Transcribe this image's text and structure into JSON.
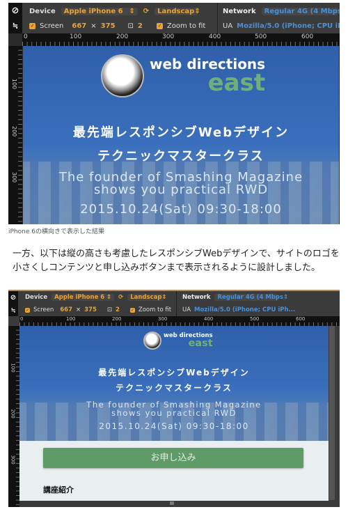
{
  "devtools": {
    "device_label": "Device",
    "device_value": "Apple iPhone 6",
    "orientation": "Landscap",
    "network_label": "Network",
    "network_value": "Regular 4G (4 Mbps",
    "screen_label": "Screen",
    "screen_w": "667",
    "times": "×",
    "screen_h": "375",
    "dpr": "2",
    "zoom_label": "Zoom to fit",
    "ua_label": "UA",
    "ua_value": "Mozilla/5.0 (iPhone; CPU iPh...",
    "ruler_ticks": [
      "0",
      "100",
      "200",
      "300",
      "400",
      "500",
      "600"
    ],
    "vruler_ticks": [
      "100",
      "200",
      "300"
    ],
    "icons": [
      "no-entry-icon",
      "emulation-icon",
      "rotate-icon",
      "dpr-icon",
      "select-arrows-icon",
      "checkbox-icon"
    ]
  },
  "site": {
    "logo_line1": "web directions",
    "logo_line2": "east",
    "title1": "最先端レスポンシブWebデザイン",
    "title2": "テクニックマスタークラス",
    "sub1": "The founder of Smashing Magazine",
    "sub2": "shows you practical RWD",
    "date": "2015.10.24(Sat) 09:30-18:00",
    "apply_button": "お申し込み",
    "section_heading": "講座紹介"
  },
  "article": {
    "caption1": "iPhone 6の横向きで表示した結果",
    "paragraph": "一方、以下は縦の高さも考慮したレスポンシブWebデザインで、サイトのロゴを小さくしコンテンツと申し込みボタンまで表示されるように設計しました。"
  },
  "colors": {
    "accent_orange": "#e8a43a",
    "accent_blue": "#4a90d9",
    "button_green": "#5f9b66",
    "logo_green": "#6fb07a"
  }
}
